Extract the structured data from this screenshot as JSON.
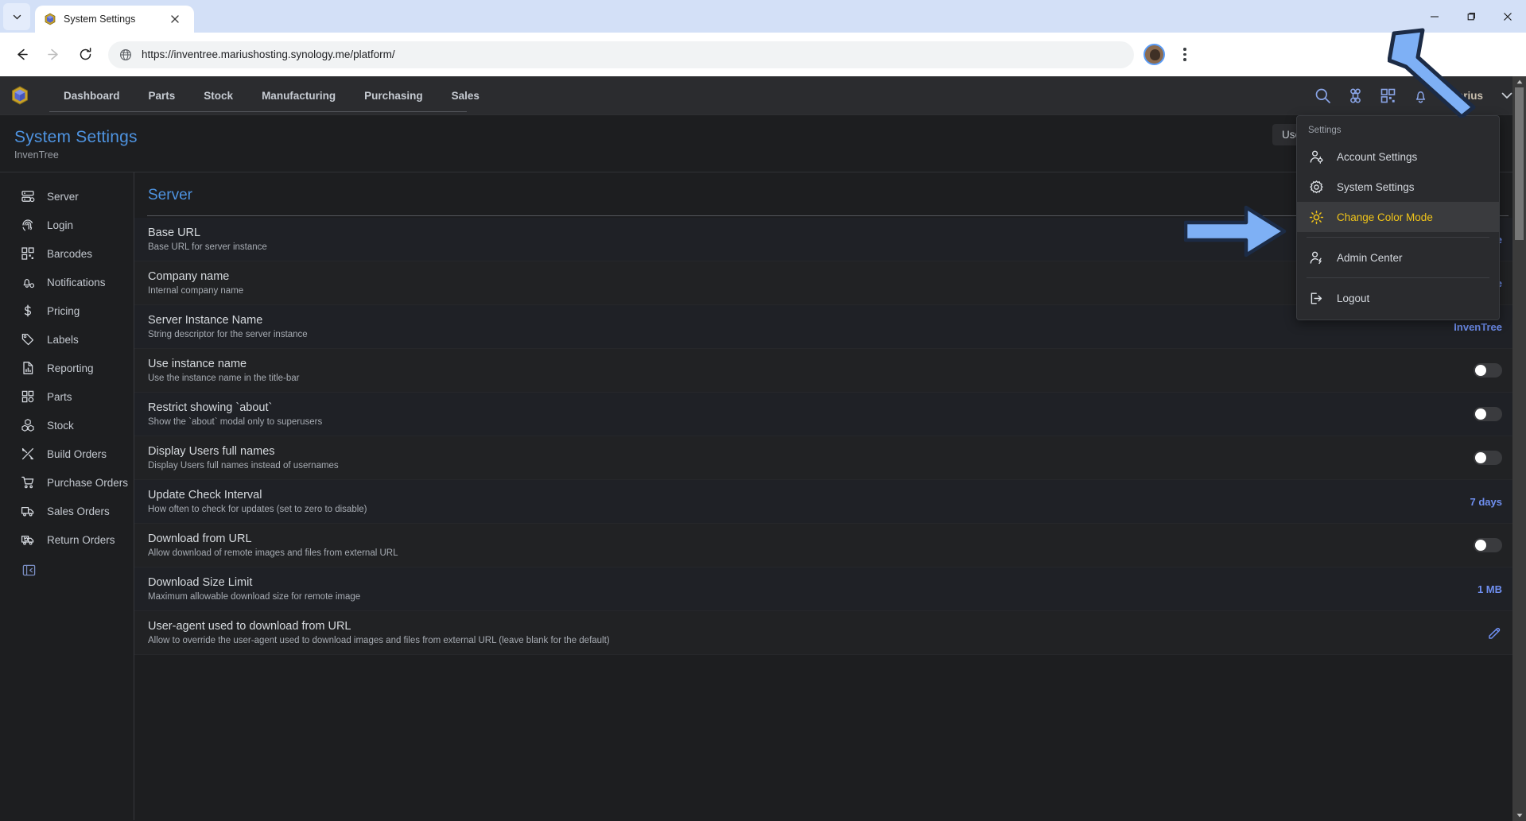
{
  "browser": {
    "tab": {
      "title": "System Settings",
      "favicon": "inventree-cube-icon",
      "close_icon": "close-icon"
    },
    "tabstrip_chevron_icon": "chevron-down-icon",
    "window_controls": {
      "minimize": "minimize-icon",
      "maximize": "maximize-icon",
      "close": "close-icon"
    },
    "toolbar": {
      "back_icon": "arrow-left-icon",
      "forward_icon": "arrow-right-icon",
      "reload_icon": "reload-icon",
      "site_icon": "globe-icon",
      "url": "https://inventree.mariushosting.synology.me/platform/",
      "profile_icon": "avatar",
      "menu_icon": "kebab-menu-icon"
    }
  },
  "app": {
    "logo_icon": "inventree-logo-icon",
    "nav": [
      {
        "label": "Dashboard"
      },
      {
        "label": "Parts"
      },
      {
        "label": "Stock"
      },
      {
        "label": "Manufacturing"
      },
      {
        "label": "Purchasing"
      },
      {
        "label": "Sales"
      }
    ],
    "header_icons": [
      {
        "name": "search-icon"
      },
      {
        "name": "command-icon"
      },
      {
        "name": "qr-scan-icon"
      },
      {
        "name": "notifications-bell-icon"
      }
    ],
    "username": "marius",
    "user_chevron_icon": "chevron-down-icon"
  },
  "page": {
    "title": "System Settings",
    "subtitle": "InvenTree",
    "user_settings_button": "User Settings"
  },
  "sidebar": {
    "items": [
      {
        "label": "Server",
        "icon": "server-icon"
      },
      {
        "label": "Login",
        "icon": "fingerprint-icon"
      },
      {
        "label": "Barcodes",
        "icon": "barcode-icon"
      },
      {
        "label": "Notifications",
        "icon": "bell-settings-icon"
      },
      {
        "label": "Pricing",
        "icon": "dollar-icon"
      },
      {
        "label": "Labels",
        "icon": "tag-icon"
      },
      {
        "label": "Reporting",
        "icon": "report-icon"
      },
      {
        "label": "Parts",
        "icon": "parts-grid-icon"
      },
      {
        "label": "Stock",
        "icon": "boxes-icon"
      },
      {
        "label": "Build Orders",
        "icon": "tools-icon"
      },
      {
        "label": "Purchase Orders",
        "icon": "shopping-cart-icon"
      },
      {
        "label": "Sales Orders",
        "icon": "truck-icon"
      },
      {
        "label": "Return Orders",
        "icon": "truck-return-icon"
      }
    ],
    "collapse_icon": "panel-collapse-icon"
  },
  "settings": {
    "section_title": "Server",
    "rows": [
      {
        "name": "Base URL",
        "desc": "Base URL for server instance",
        "value": "https://inve",
        "type": "text"
      },
      {
        "name": "Company name",
        "desc": "Internal company name",
        "value": "My company name",
        "type": "text"
      },
      {
        "name": "Server Instance Name",
        "desc": "String descriptor for the server instance",
        "value": "InvenTree",
        "type": "text"
      },
      {
        "name": "Use instance name",
        "desc": "Use the instance name in the title-bar",
        "value": "off",
        "type": "toggle"
      },
      {
        "name": "Restrict showing `about`",
        "desc": "Show the `about` modal only to superusers",
        "value": "off",
        "type": "toggle"
      },
      {
        "name": "Display Users full names",
        "desc": "Display Users full names instead of usernames",
        "value": "off",
        "type": "toggle"
      },
      {
        "name": "Update Check Interval",
        "desc": "How often to check for updates (set to zero to disable)",
        "value": "7 days",
        "type": "text"
      },
      {
        "name": "Download from URL",
        "desc": "Allow download of remote images and files from external URL",
        "value": "off",
        "type": "toggle"
      },
      {
        "name": "Download Size Limit",
        "desc": "Maximum allowable download size for remote image",
        "value": "1 MB",
        "type": "text"
      },
      {
        "name": "User-agent used to download from URL",
        "desc": "Allow to override the user-agent used to download images and files from external URL (leave blank for the default)",
        "value": "edit-icon",
        "type": "edit"
      }
    ]
  },
  "dropdown": {
    "label": "Settings",
    "items": [
      {
        "label": "Account Settings",
        "icon": "user-settings-icon",
        "highlighted": false
      },
      {
        "label": "System Settings",
        "icon": "gear-icon",
        "highlighted": false
      },
      {
        "label": "Change Color Mode",
        "icon": "sun-icon",
        "highlighted": true
      },
      {
        "label": "Admin Center",
        "icon": "user-admin-icon",
        "highlighted": false
      },
      {
        "label": "Logout",
        "icon": "logout-icon",
        "highlighted": false
      }
    ]
  },
  "annotations": {
    "arrows": [
      {
        "name": "arrow-pointing-to-user-menu",
        "color": "#7eb0f5"
      },
      {
        "name": "arrow-pointing-to-change-color-mode",
        "color": "#7eb0f5"
      }
    ]
  },
  "colors": {
    "accent_blue": "#6f8ff0",
    "title_blue": "#4e93e0",
    "highlight_yellow": "#f0c419",
    "arrow_blue": "#7eb0f5"
  }
}
